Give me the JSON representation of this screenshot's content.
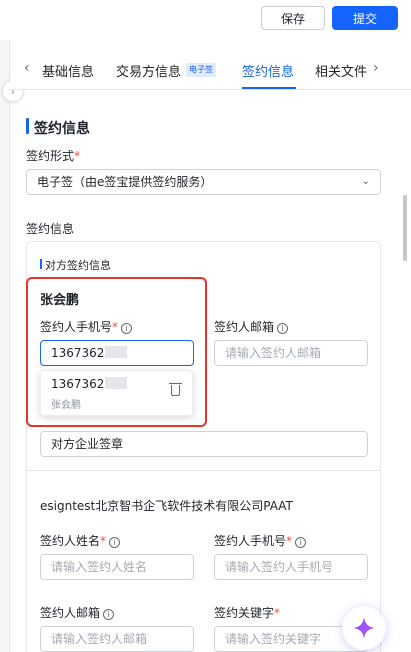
{
  "toolbar": {
    "save_label": "保存",
    "submit_label": "提交"
  },
  "tabs": {
    "items": [
      {
        "label": "基础信息"
      },
      {
        "label": "交易方信息"
      },
      {
        "label": "签约信息"
      },
      {
        "label": "相关文件"
      }
    ],
    "badge": "电子签",
    "active_index": 2
  },
  "section": {
    "title": "签约信息"
  },
  "form": {
    "sign_type_label": "签约形式",
    "sign_type_value": "电子签（由e签宝提供签约服务）",
    "sign_info_label": "签约信息"
  },
  "counterparty": {
    "title": "对方签约信息",
    "signer_name": "张会鹏",
    "phone_label": "签约人手机号",
    "phone_value": "1367362",
    "email_label": "签约人邮箱",
    "email_placeholder": "请输入签约人邮箱",
    "keyword_value": "对方企业签章",
    "dropdown": {
      "phone": "1367362",
      "name": "张会鹏"
    }
  },
  "own_party": {
    "company": "esigntest北京智书企飞软件技术有限公司PAAT",
    "name_label": "签约人姓名",
    "name_placeholder": "请输入签约人姓名",
    "phone_label": "签约人手机号",
    "phone_placeholder": "请输入签约人手机号",
    "email_label": "签约人邮箱",
    "email_placeholder": "请输入签约人邮箱",
    "keyword_label": "签约关键字",
    "keyword_placeholder": "请输入签约关键字"
  },
  "colors": {
    "accent": "#1664ff",
    "highlight": "#e8332e",
    "required": "#f54a45"
  }
}
